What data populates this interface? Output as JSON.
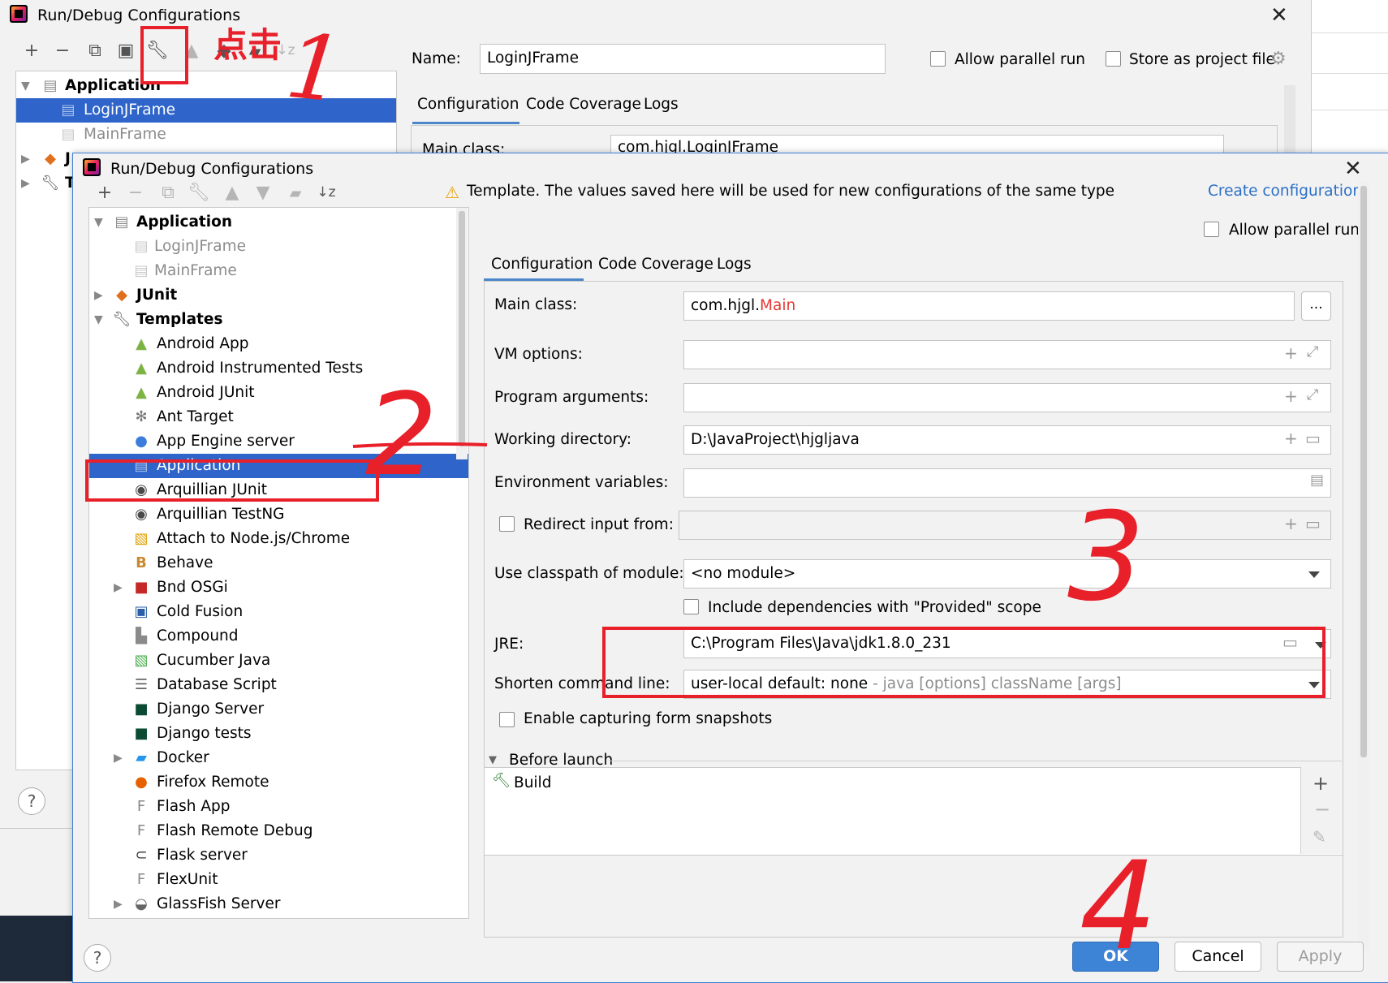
{
  "back_window": {
    "title": "Run/Debug Configurations",
    "name_label": "Name:",
    "name_value": "LoginJFrame",
    "allow_parallel_run": "Allow parallel run",
    "store_as_project_file": "Store as project file",
    "tabs": [
      "Configuration",
      "Code Coverage",
      "Logs"
    ],
    "main_class_label": "Main class:",
    "main_class_value": "com.hjgl.LoginJFrame",
    "tree": {
      "application": "Application",
      "items": [
        "LoginJFrame",
        "MainFrame"
      ],
      "junit_partial": "J",
      "templates_partial": "T"
    }
  },
  "front_window": {
    "title": "Run/Debug Configurations",
    "template_notice": "Template. The values saved here will be used for new configurations of the same type",
    "create_configuration": "Create configuration",
    "allow_parallel_run": "Allow parallel run",
    "tabs": [
      "Configuration",
      "Code Coverage",
      "Logs"
    ],
    "tree": {
      "application": "Application",
      "app_children": [
        "LoginJFrame",
        "MainFrame"
      ],
      "junit": "JUnit",
      "templates": "Templates",
      "template_items": [
        "Android App",
        "Android Instrumented Tests",
        "Android JUnit",
        "Ant Target",
        "App Engine server",
        "Application",
        "Arquillian JUnit",
        "Arquillian TestNG",
        "Attach to Node.js/Chrome",
        "Behave",
        "Bnd OSGi",
        "Cold Fusion",
        "Compound",
        "Cucumber Java",
        "Database Script",
        "Django Server",
        "Django tests",
        "Docker",
        "Firefox Remote",
        "Flash App",
        "Flash Remote Debug",
        "Flask server",
        "FlexUnit",
        "GlassFish Server"
      ]
    },
    "form": {
      "main_class_label": "Main class:",
      "main_class_prefix": "com.hjgl.",
      "main_class_highlight": "Main",
      "browse": "...",
      "vm_options_label": "VM options:",
      "program_args_label": "Program arguments:",
      "working_dir_label": "Working directory:",
      "working_dir_value": "D:\\JavaProject\\hjgljava",
      "env_vars_label": "Environment variables:",
      "redirect_input_label": "Redirect input from:",
      "classpath_label": "Use classpath of module:",
      "classpath_value": "<no module>",
      "include_deps": "Include dependencies with \"Provided\" scope",
      "jre_label": "JRE:",
      "jre_value": "C:\\Program Files\\Java\\jdk1.8.0_231",
      "shorten_label": "Shorten command line:",
      "shorten_value": "user-local default: none",
      "shorten_hint": " - java [options] className [args]",
      "enable_snapshots": "Enable capturing form snapshots"
    },
    "before_launch": {
      "title": "Before launch",
      "items": [
        "Build"
      ]
    },
    "buttons": {
      "ok": "OK",
      "cancel": "Cancel",
      "apply": "Apply"
    }
  },
  "annotations": {
    "click_text": "点击",
    "step1": "1",
    "step2": "2",
    "step3": "3",
    "step4": "4"
  },
  "colors": {
    "selection": "#2f65ca",
    "annotation_red": "#e8202a",
    "link": "#2b6fc5",
    "ok_button": "#3d83d6"
  }
}
